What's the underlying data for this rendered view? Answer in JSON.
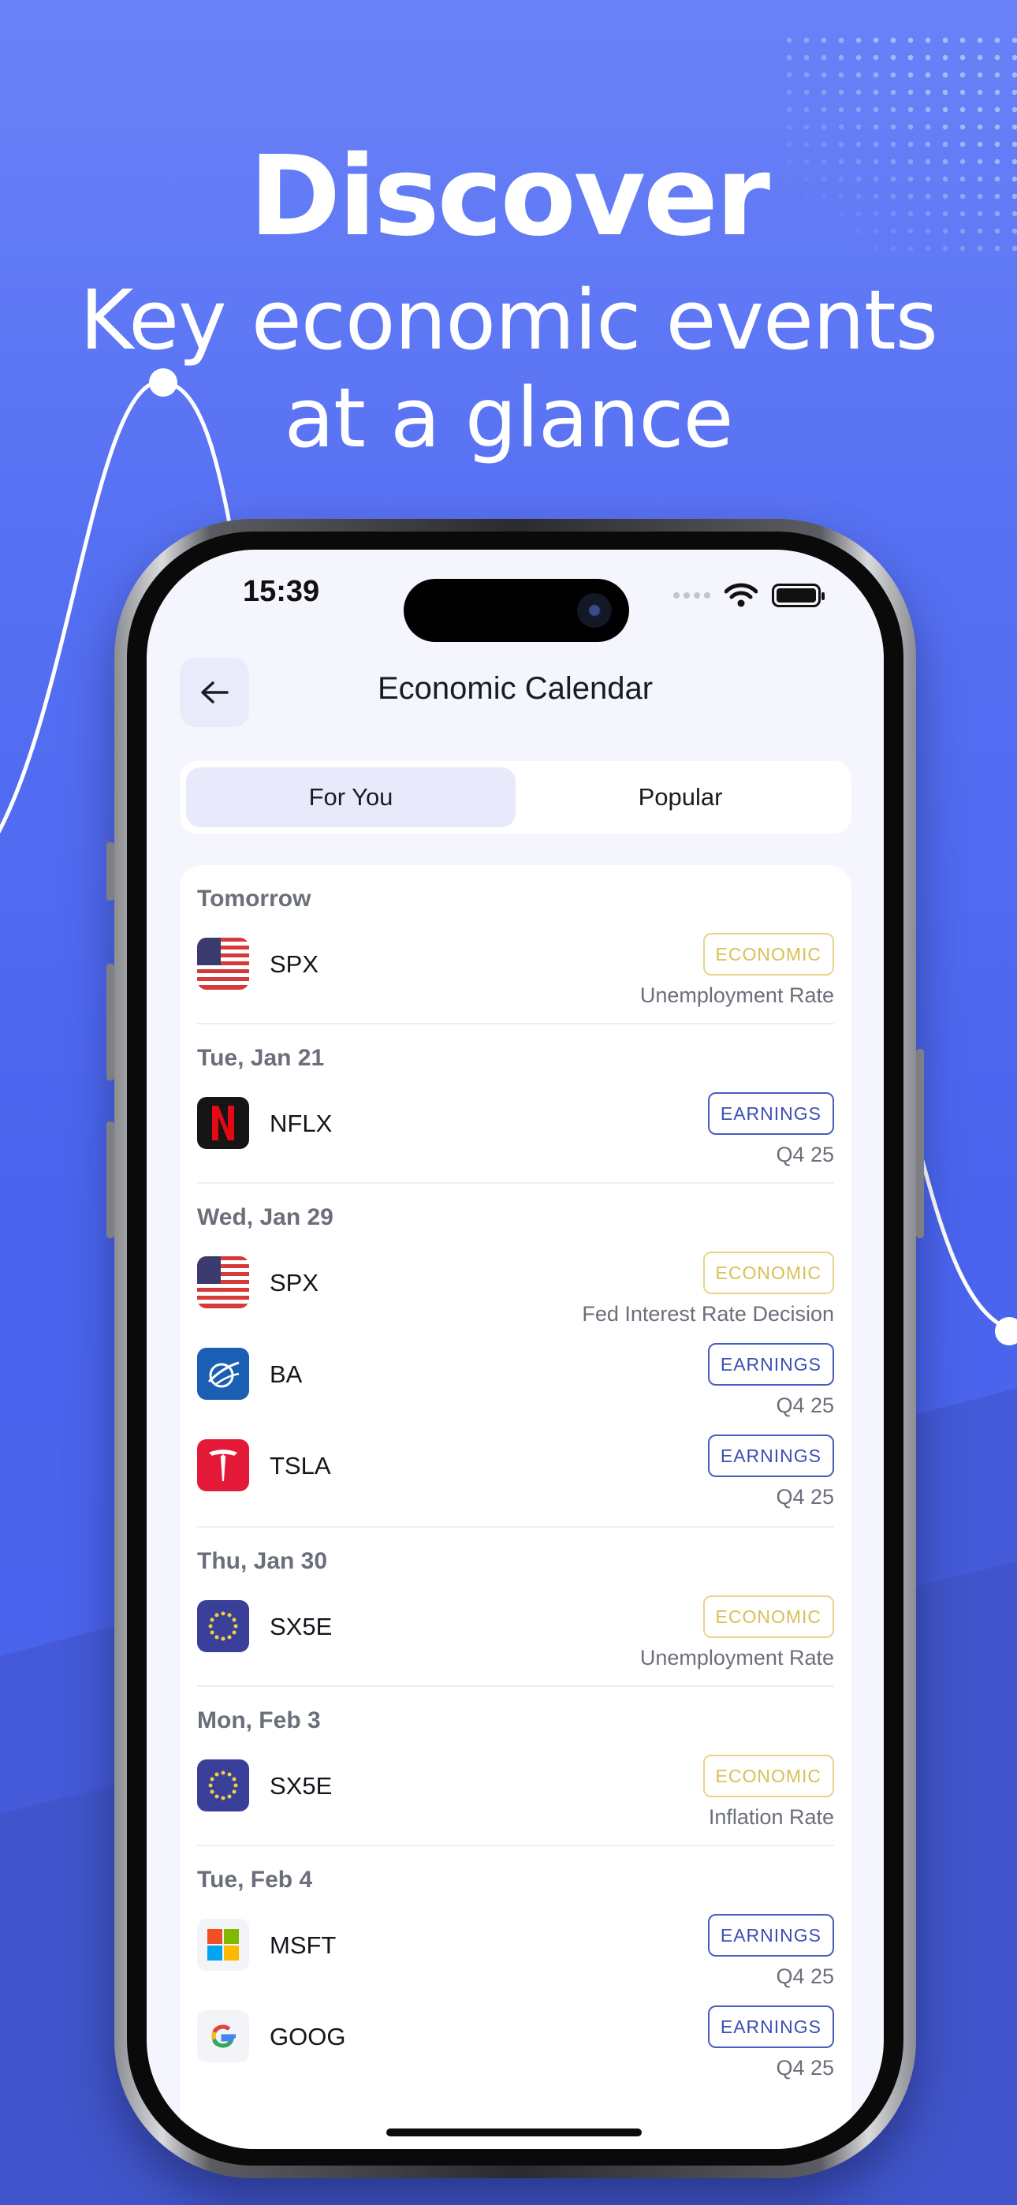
{
  "promo": {
    "headline": "Discover",
    "subhead_line1": "Key economic events",
    "subhead_line2": "at a glance"
  },
  "status_bar": {
    "time": "15:39"
  },
  "nav": {
    "title": "Economic Calendar",
    "back_icon": "arrow-left-icon"
  },
  "tabs": [
    {
      "label": "For You",
      "active": true
    },
    {
      "label": "Popular",
      "active": false
    }
  ],
  "calendar": {
    "groups": [
      {
        "date": "Tomorrow",
        "events": [
          {
            "ticker": "SPX",
            "logo": "us-flag",
            "type": "ECONOMIC",
            "kind": "eco",
            "detail": "Unemployment Rate"
          }
        ]
      },
      {
        "date": "Tue, Jan 21",
        "events": [
          {
            "ticker": "NFLX",
            "logo": "netflix",
            "type": "EARNINGS",
            "kind": "earn",
            "detail": "Q4 25"
          }
        ]
      },
      {
        "date": "Wed, Jan 29",
        "events": [
          {
            "ticker": "SPX",
            "logo": "us-flag",
            "type": "ECONOMIC",
            "kind": "eco",
            "detail": "Fed Interest Rate Decision"
          },
          {
            "ticker": "BA",
            "logo": "boeing",
            "type": "EARNINGS",
            "kind": "earn",
            "detail": "Q4 25"
          },
          {
            "ticker": "TSLA",
            "logo": "tesla",
            "type": "EARNINGS",
            "kind": "earn",
            "detail": "Q4 25"
          }
        ]
      },
      {
        "date": "Thu, Jan 30",
        "events": [
          {
            "ticker": "SX5E",
            "logo": "eu-flag",
            "type": "ECONOMIC",
            "kind": "eco",
            "detail": "Unemployment Rate"
          }
        ]
      },
      {
        "date": "Mon, Feb 3",
        "events": [
          {
            "ticker": "SX5E",
            "logo": "eu-flag",
            "type": "ECONOMIC",
            "kind": "eco",
            "detail": "Inflation Rate"
          }
        ]
      },
      {
        "date": "Tue, Feb 4",
        "events": [
          {
            "ticker": "MSFT",
            "logo": "microsoft",
            "type": "EARNINGS",
            "kind": "earn",
            "detail": "Q4 25"
          },
          {
            "ticker": "GOOG",
            "logo": "google",
            "type": "EARNINGS",
            "kind": "earn",
            "detail": "Q4 25"
          }
        ]
      }
    ]
  },
  "colors": {
    "background": "#4a64ee",
    "economic_badge": "#d8bf55",
    "earnings_badge": "#3b4fb4",
    "active_tab": "#e8e9fb"
  }
}
